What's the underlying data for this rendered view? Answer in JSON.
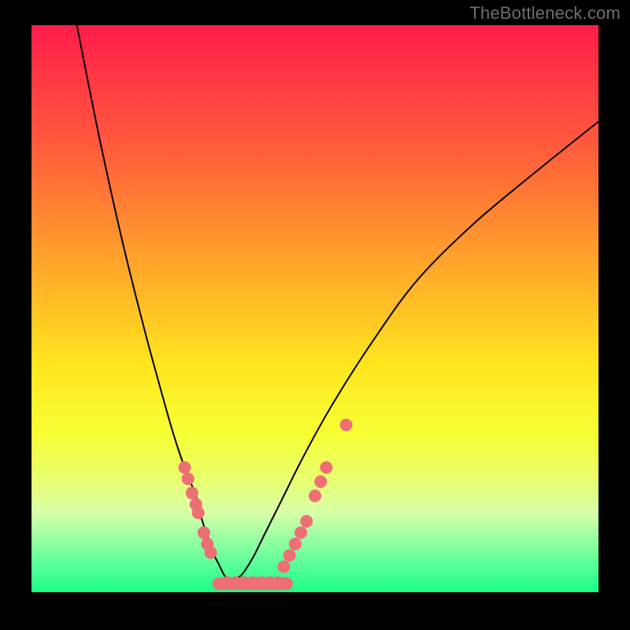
{
  "watermark": "TheBottleneck.com",
  "colors": {
    "frame_bg": "#000000",
    "curve_stroke": "#000000",
    "dot_fill": "#ee6e76",
    "gradient_top": "#ff1d4a",
    "gradient_bottom": "#19ff86"
  },
  "chart_data": {
    "type": "line",
    "title": "",
    "xlabel": "",
    "ylabel": "",
    "xlim": [
      0,
      100
    ],
    "ylim": [
      0,
      100
    ],
    "grid": false,
    "legend": false,
    "note": "Values read off an unlabeled bottleneck-style V curve rendered over a vertical color gradient. x and y are percentages of the plot area (0 = left/top for x/y-from-top).",
    "series": [
      {
        "name": "left-branch",
        "x": [
          8,
          12,
          16,
          20,
          23,
          25,
          27,
          29,
          30,
          31,
          32,
          33,
          34,
          35
        ],
        "y_from_top": [
          0,
          20,
          38,
          54,
          65,
          72,
          78,
          83,
          87,
          90,
          93,
          95,
          97,
          98
        ]
      },
      {
        "name": "right-branch",
        "x": [
          35,
          37,
          39,
          41,
          44,
          48,
          53,
          60,
          68,
          78,
          90,
          100
        ],
        "y_from_top": [
          98,
          97,
          94,
          90,
          84,
          76,
          67,
          56,
          45,
          35,
          25,
          17
        ]
      },
      {
        "name": "valley-floor",
        "x": [
          33,
          35,
          37,
          39,
          41,
          43,
          45
        ],
        "y_from_top": [
          98.5,
          98.5,
          98.5,
          98.5,
          98.5,
          98.5,
          98.5
        ]
      }
    ],
    "scatter": [
      {
        "name": "left-cluster-upper",
        "x": [
          27.0,
          27.6,
          28.3,
          29.0,
          29.4
        ],
        "y_from_top": [
          78.0,
          80.0,
          82.5,
          84.5,
          86.0
        ]
      },
      {
        "name": "left-cluster-lower",
        "x": [
          30.4,
          31.0,
          31.6
        ],
        "y_from_top": [
          89.5,
          91.5,
          93.0
        ]
      },
      {
        "name": "valley-dots",
        "x": [
          34.5,
          36.0,
          37.5,
          39.0,
          40.5,
          42.0,
          43.5
        ],
        "y_from_top": [
          98.3,
          98.3,
          98.3,
          98.3,
          98.3,
          98.3,
          98.3
        ]
      },
      {
        "name": "right-cluster-lower",
        "x": [
          44.5,
          45.5,
          46.5,
          47.5,
          48.5
        ],
        "y_from_top": [
          95.5,
          93.5,
          91.5,
          89.5,
          87.5
        ]
      },
      {
        "name": "right-cluster-upper",
        "x": [
          50.0,
          51.0,
          52.0
        ],
        "y_from_top": [
          83.0,
          80.5,
          78.0
        ]
      },
      {
        "name": "right-isolated",
        "x": [
          55.5
        ],
        "y_from_top": [
          70.5
        ]
      }
    ],
    "gradient_bands_y_from_top": {
      "red": 0,
      "orange": 35,
      "yellow": 62,
      "light_yellow": 78,
      "green": 94
    }
  }
}
